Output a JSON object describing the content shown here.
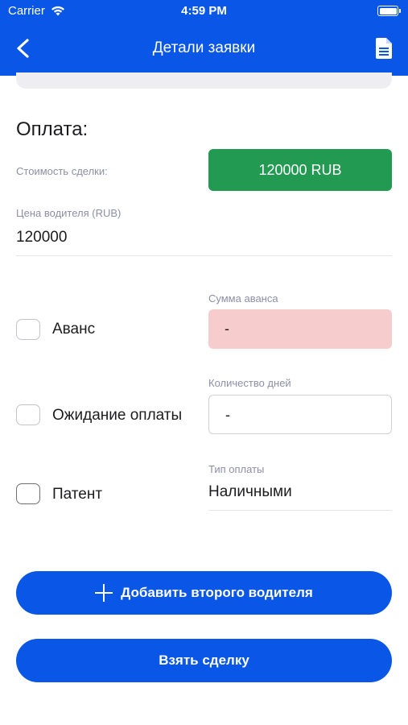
{
  "status_bar": {
    "carrier": "Carrier",
    "time": "4:59 PM"
  },
  "nav": {
    "title": "Детали заявки",
    "back_icon": "chevron-left-icon",
    "doc_icon": "document-icon"
  },
  "payment": {
    "section_title": "Оплата:",
    "deal_cost_label": "Стоимость сделки:",
    "deal_cost_value": "120000 RUB",
    "driver_price_label": "Цена водителя (RUB)",
    "driver_price_value": "120000"
  },
  "options": {
    "advance": {
      "label": "Аванс",
      "checked": false,
      "field_label": "Сумма аванса",
      "field_value": "-"
    },
    "awaiting": {
      "label": "Ожидание оплаты",
      "checked": false,
      "field_label": "Количество дней",
      "field_value": "-"
    },
    "patent": {
      "label": "Патент",
      "checked": false,
      "field_label": "Тип оплаты",
      "field_value": "Наличными"
    }
  },
  "buttons": {
    "add_driver": "Добавить второго водителя",
    "take_deal": "Взять сделку"
  },
  "colors": {
    "brand_blue": "#0a56e6",
    "success_green": "#229a52",
    "error_bg": "#f7cccc"
  }
}
